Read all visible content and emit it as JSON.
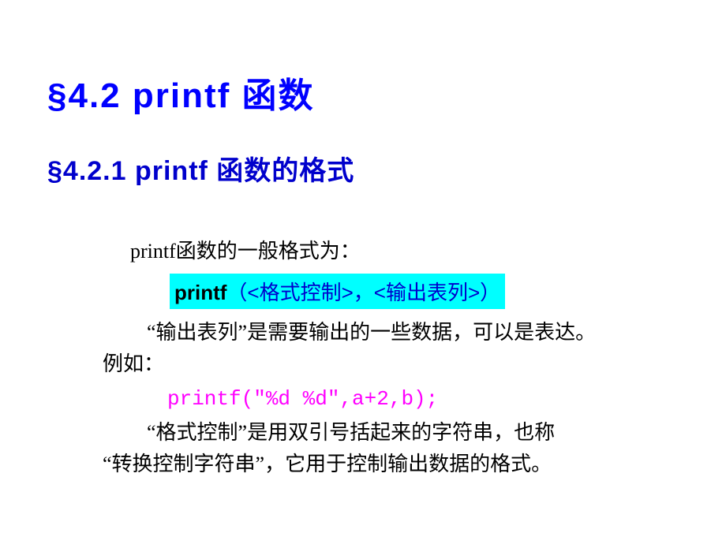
{
  "main_title": "§4.2   printf 函数",
  "sub_title": "§4.2.1   printf 函数的格式",
  "intro": "printf函数的一般格式为：",
  "highlight": {
    "printf": "printf",
    "args": "（<格式控制>，<输出表列>）"
  },
  "para1_line1": "“输出表列”是需要输出的一些数据，可以是表达。",
  "para1_line2": "例如：",
  "code": "printf(\"%d %d\",a+2,b);",
  "para2_line1": "“格式控制”是用双引号括起来的字符串，也称",
  "para2_line2": "“转换控制字符串”，它用于控制输出数据的格式。"
}
